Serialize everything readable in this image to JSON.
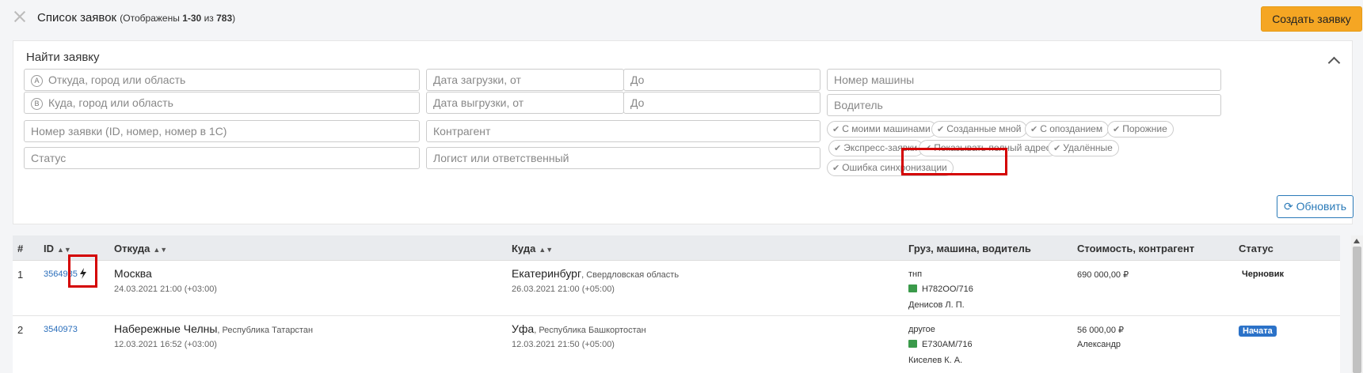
{
  "header": {
    "title": "Список заявок",
    "subtitle_prefix": "(Отображены",
    "range": "1-30",
    "of": "из",
    "total": "783",
    "subtitle_suffix": ")",
    "create_label": "Создать заявку"
  },
  "filter": {
    "title": "Найти заявку",
    "from_placeholder": "Откуда, город или область",
    "from_badge": "A",
    "to_placeholder": "Куда, город или область",
    "to_badge": "B",
    "load_from": "Дата загрузки, от",
    "load_to": "До",
    "unload_from": "Дата выгрузки, от",
    "unload_to": "До",
    "vehicle_number": "Номер машины",
    "driver": "Водитель",
    "order_number": "Номер заявки (ID, номер, номер в 1С)",
    "counterparty": "Контрагент",
    "status": "Статус",
    "logist": "Логист или ответственный",
    "chips": [
      "С моими машинами",
      "Созданные мной",
      "С опозданием",
      "Порожние",
      "Экспресс-заявки",
      "Показывать полный адрес",
      "Удалённые",
      "Ошибка синхронизации"
    ],
    "refresh_label": "Обновить"
  },
  "table": {
    "headers": {
      "num": "#",
      "id": "ID",
      "from": "Откуда",
      "to": "Куда",
      "cargo": "Груз, машина, водитель",
      "cost": "Стоимость, контрагент",
      "status": "Статус"
    },
    "rows": [
      {
        "num": "1",
        "id": "3564985",
        "from_city": "Москва",
        "from_region": "",
        "from_date": "24.03.2021 21:00 (+03:00)",
        "to_city": "Екатеринбург",
        "to_region": ", Свердловская область",
        "to_date": "26.03.2021 21:00 (+05:00)",
        "cargo": "тнп",
        "plate": "Н782ОО/716",
        "driver": "Денисов Л. П.",
        "cost": "690 000,00 ₽",
        "counterparty": "",
        "status": "Черновик"
      },
      {
        "num": "2",
        "id": "3540973",
        "from_city": "Набережные Челны",
        "from_region": ", Республика Татарстан",
        "from_date": "12.03.2021 16:52 (+03:00)",
        "to_city": "Уфа",
        "to_region": ", Республика Башкортостан",
        "to_date": "12.03.2021 21:50 (+05:00)",
        "cargo": "другое",
        "plate": "Е730АМ/716",
        "driver": "Киселев К. А.",
        "cost": "56 000,00 ₽",
        "counterparty": "Александр",
        "status": "Начата"
      }
    ]
  },
  "colors": {
    "accent_orange": "#f5a623",
    "link_blue": "#2a6ebb",
    "highlight_red": "#d40000",
    "badge_blue": "#2b72c8",
    "truck_green": "#3a9a4a"
  },
  "icons": [
    "close-icon",
    "chevron-up-icon",
    "check-icon",
    "refresh-icon",
    "sort-icon",
    "bolt-icon",
    "truck-icon"
  ]
}
